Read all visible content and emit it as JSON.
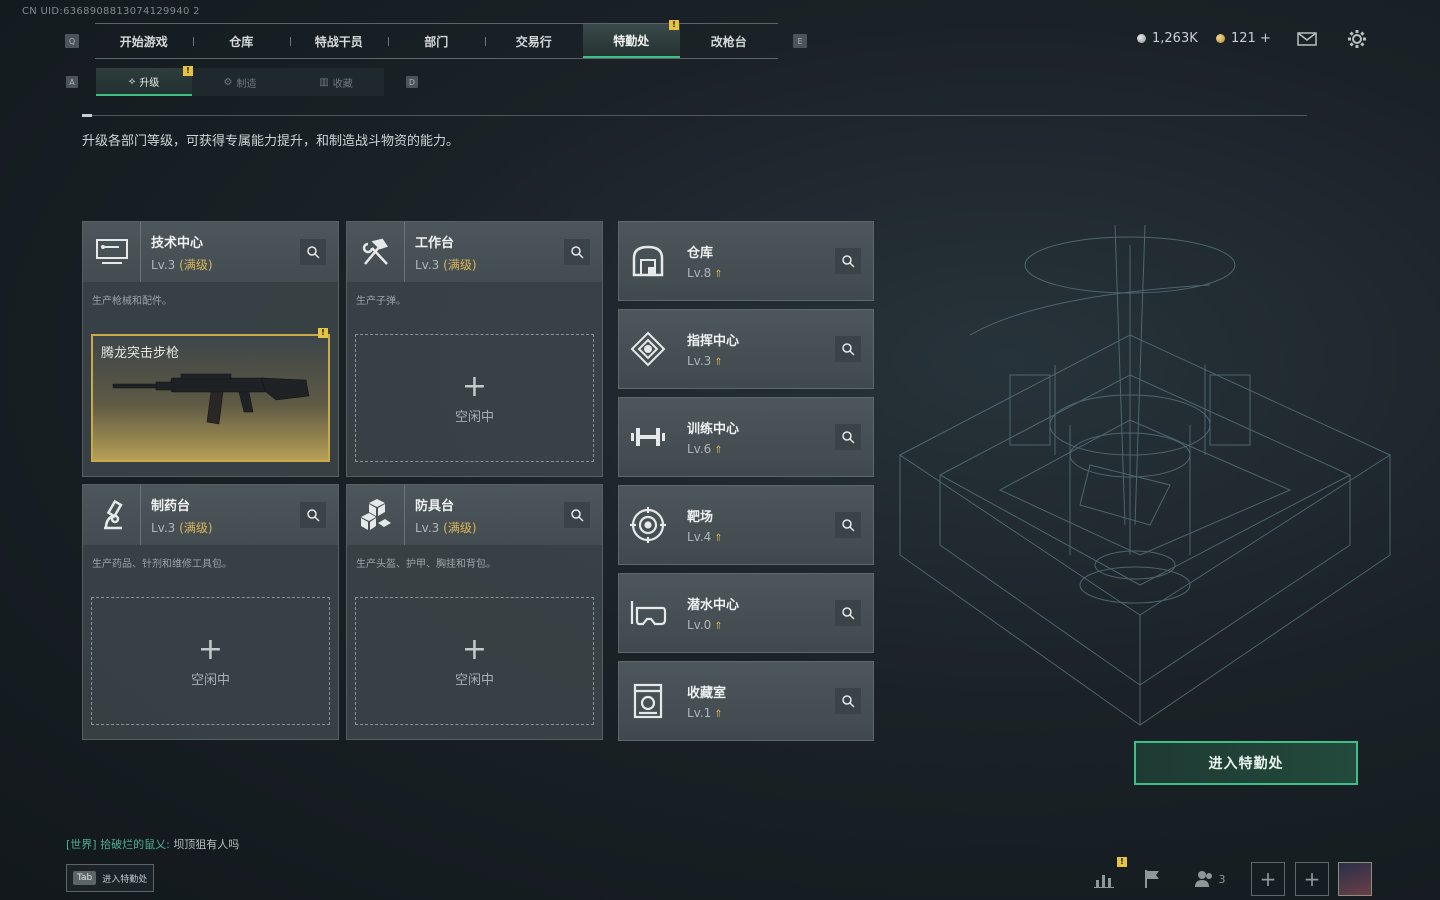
{
  "uid": "CN UID:6368908813074129940 2",
  "nav": {
    "left_key": "Q",
    "right_key": "E",
    "tabs": [
      "开始游戏",
      "仓库",
      "特战干员",
      "部门",
      "交易行",
      "特勤处",
      "改枪台"
    ],
    "active_index": 5
  },
  "currency": {
    "silver": "1,263K",
    "gold": "121 +"
  },
  "subnav": {
    "left_key": "A",
    "right_key": "D",
    "tabs": [
      "升级",
      "制造",
      "收藏"
    ],
    "active_index": 0
  },
  "description": "升级各部门等级，可获得专属能力提升，和制造战斗物资的能力。",
  "workshops": [
    {
      "title": "技术中心",
      "level": "Lv.3",
      "max": "(满级)",
      "subtitle": "生产枪械和配件。",
      "slot": "腾龙突击步枪",
      "icon": "monitor-icon"
    },
    {
      "title": "工作台",
      "level": "Lv.3",
      "max": "(满级)",
      "subtitle": "生产子弹。",
      "slot_empty": "空闲中",
      "icon": "hammer-wrench-icon"
    },
    {
      "title": "制药台",
      "level": "Lv.3",
      "max": "(满级)",
      "subtitle": "生产药品、针剂和维修工具包。",
      "slot_empty": "空闲中",
      "icon": "microscope-icon"
    },
    {
      "title": "防具台",
      "level": "Lv.3",
      "max": "(满级)",
      "subtitle": "生产头盔、护甲、胸挂和背包。",
      "slot_empty": "空闲中",
      "icon": "armor-blocks-icon"
    }
  ],
  "departments": [
    {
      "title": "仓库",
      "level": "Lv.8",
      "icon": "warehouse-icon"
    },
    {
      "title": "指挥中心",
      "level": "Lv.3",
      "icon": "command-icon"
    },
    {
      "title": "训练中心",
      "level": "Lv.6",
      "icon": "dumbbell-icon"
    },
    {
      "title": "靶场",
      "level": "Lv.4",
      "icon": "target-icon"
    },
    {
      "title": "潜水中心",
      "level": "Lv.0",
      "icon": "diving-mask-icon"
    },
    {
      "title": "收藏室",
      "level": "Lv.1",
      "icon": "collection-icon"
    }
  ],
  "enter_button": "进入特勤处",
  "chat": {
    "channel": "[世界]",
    "user": "拾破烂的鼠乂:",
    "message": "坝顶狙有人吗"
  },
  "tab_hint": {
    "key": "Tab",
    "label": "进入特勤处"
  },
  "squad_count": "3",
  "colors": {
    "accent": "#3fbf88",
    "gold": "#d9b458",
    "notif": "#e6c341"
  }
}
